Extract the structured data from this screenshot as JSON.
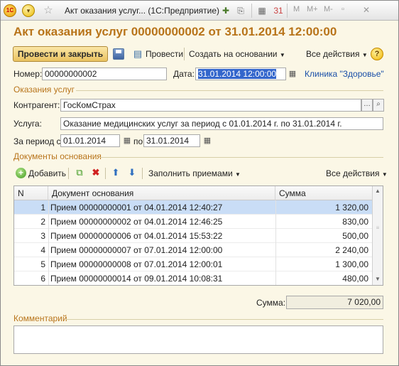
{
  "titlebar": {
    "logo": "1C",
    "window_title": "Акт оказания услуг...  (1С:Предприятие)",
    "grey_letters": [
      "M",
      "M+",
      "M-"
    ],
    "icons": [
      "app-logo-icon",
      "menu-circle-icon",
      "favorite-star-icon",
      "add-favorite-icon",
      "link-icon",
      "calculator-icon",
      "calendar-icon",
      "restore-icon",
      "close-icon"
    ]
  },
  "document": {
    "title": "Акт оказания услуг 00000000002 от 31.01.2014 12:00:00"
  },
  "toolbar": {
    "post_and_close": "Провести и закрыть",
    "post": "Провести",
    "create_based_on": "Создать на основании",
    "all_actions": "Все действия",
    "help": "?"
  },
  "header_fields": {
    "number_label": "Номер:",
    "number_value": "00000000002",
    "date_label": "Дата:",
    "date_value": "31.01.2014 12:00:00",
    "organization_link": "Клиника \"Здоровье\""
  },
  "services_group": {
    "title": "Оказания услуг",
    "counterparty_label": "Контрагент:",
    "counterparty_value": "ГосКомСтрах",
    "service_label": "Услуга:",
    "service_value": "Оказание медицинских услуг за период с 01.01.2014 г. по 31.01.2014 г.",
    "period_label": "За период с:",
    "period_from": "01.01.2014",
    "period_to_label": "по:",
    "period_to": "31.01.2014"
  },
  "base_docs_group": {
    "title": "Документы основания",
    "add": "Добавить",
    "fill_from_visits": "Заполнить приемами",
    "all_actions": "Все действия"
  },
  "table": {
    "columns": [
      "N",
      "Документ основания",
      "Сумма"
    ],
    "rows": [
      {
        "n": "1",
        "doc": "Прием 00000000001 от 04.01.2014 12:40:27",
        "sum": "1 320,00"
      },
      {
        "n": "2",
        "doc": "Прием 00000000002 от 04.01.2014 12:46:25",
        "sum": "830,00"
      },
      {
        "n": "3",
        "doc": "Прием 00000000006 от 04.01.2014 15:53:22",
        "sum": "500,00"
      },
      {
        "n": "4",
        "doc": "Прием 00000000007 от 07.01.2014 12:00:00",
        "sum": "2 240,00"
      },
      {
        "n": "5",
        "doc": "Прием 00000000008 от 07.01.2014 12:00:01",
        "sum": "1 300,00"
      },
      {
        "n": "6",
        "doc": "Прием 00000000014 от 09.01.2014 10:08:31",
        "sum": "480,00"
      }
    ],
    "selected_row": 0
  },
  "totals": {
    "sum_label": "Сумма:",
    "sum_value": "7 020,00"
  },
  "comment": {
    "title": "Комментарий",
    "value": ""
  }
}
